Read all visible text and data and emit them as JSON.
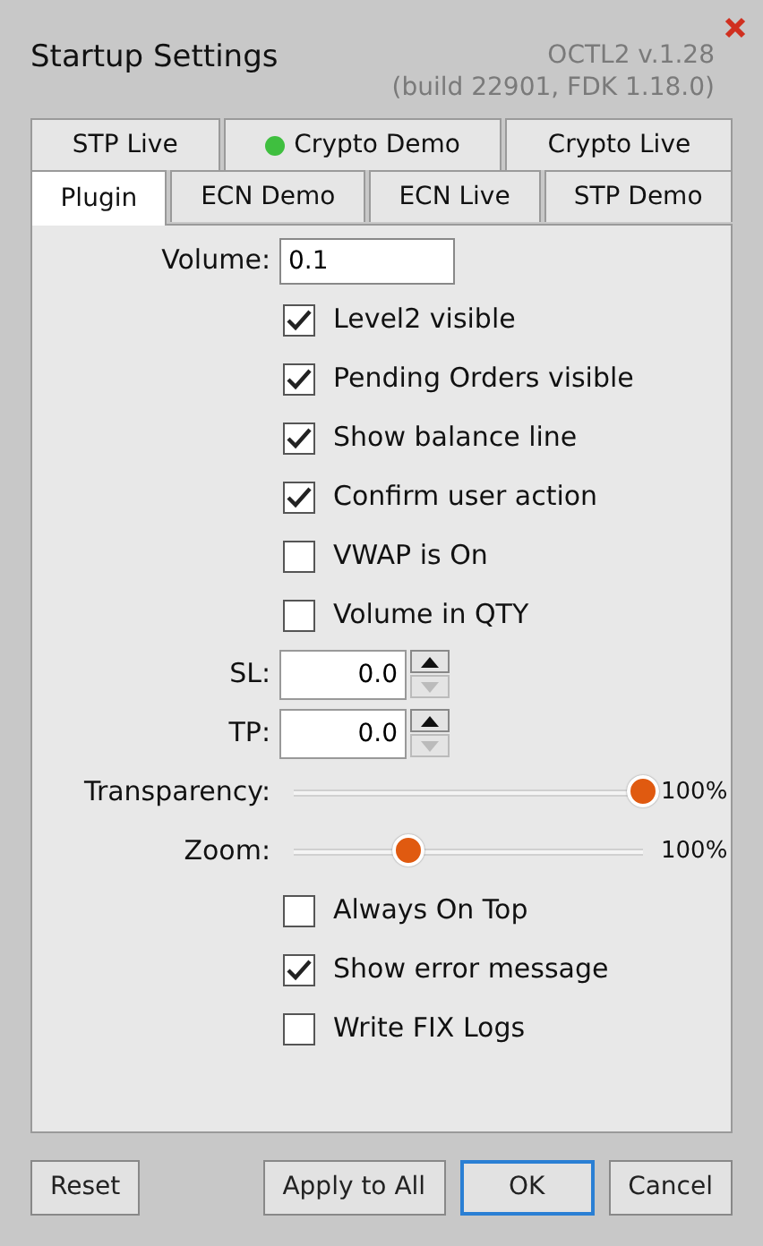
{
  "window": {
    "title": "Startup Settings",
    "version": "OCTL2  v.1.28",
    "build": "(build 22901, FDK 1.18.0)"
  },
  "tab_rows": [
    [
      {
        "label": "STP Live",
        "selected": false,
        "connected": false
      },
      {
        "label": "Crypto Demo",
        "selected": false,
        "connected": true
      },
      {
        "label": "Crypto Live",
        "selected": false,
        "connected": false
      }
    ],
    [
      {
        "label": "Plugin",
        "selected": true,
        "connected": false
      },
      {
        "label": "ECN Demo",
        "selected": false,
        "connected": false
      },
      {
        "label": "ECN Live",
        "selected": false,
        "connected": false
      },
      {
        "label": "STP Demo",
        "selected": false,
        "connected": false
      }
    ]
  ],
  "fields": [
    {
      "kind": "text",
      "label": "Volume:",
      "value": "0.1"
    },
    {
      "kind": "checkbox",
      "label": "Level2 visible",
      "checked": true
    },
    {
      "kind": "checkbox",
      "label": "Pending Orders visible",
      "checked": true
    },
    {
      "kind": "checkbox",
      "label": "Show balance line",
      "checked": true
    },
    {
      "kind": "checkbox",
      "label": "Confirm user action",
      "checked": true
    },
    {
      "kind": "checkbox",
      "label": "VWAP is On",
      "checked": false
    },
    {
      "kind": "checkbox",
      "label": "Volume in QTY",
      "checked": false
    },
    {
      "kind": "spin",
      "label": "SL:",
      "value": "0.0",
      "down_disabled": true
    },
    {
      "kind": "spin",
      "label": "TP:",
      "value": "0.0",
      "down_disabled": true
    },
    {
      "kind": "slider",
      "label": "Transparency:",
      "level": 1,
      "reading": "100%"
    },
    {
      "kind": "slider",
      "label": "Zoom:",
      "level": 0.33,
      "reading": "100%"
    },
    {
      "kind": "checkbox",
      "label": "Always On Top",
      "checked": false
    },
    {
      "kind": "checkbox",
      "label": "Show error message",
      "checked": true
    },
    {
      "kind": "checkbox",
      "label": "Write FIX Logs",
      "checked": false
    }
  ],
  "buttons": [
    {
      "label": "Reset",
      "default": false
    },
    {
      "label": "Apply to All",
      "default": false
    },
    {
      "label": "OK",
      "default": true
    },
    {
      "label": "Cancel",
      "default": false
    }
  ]
}
